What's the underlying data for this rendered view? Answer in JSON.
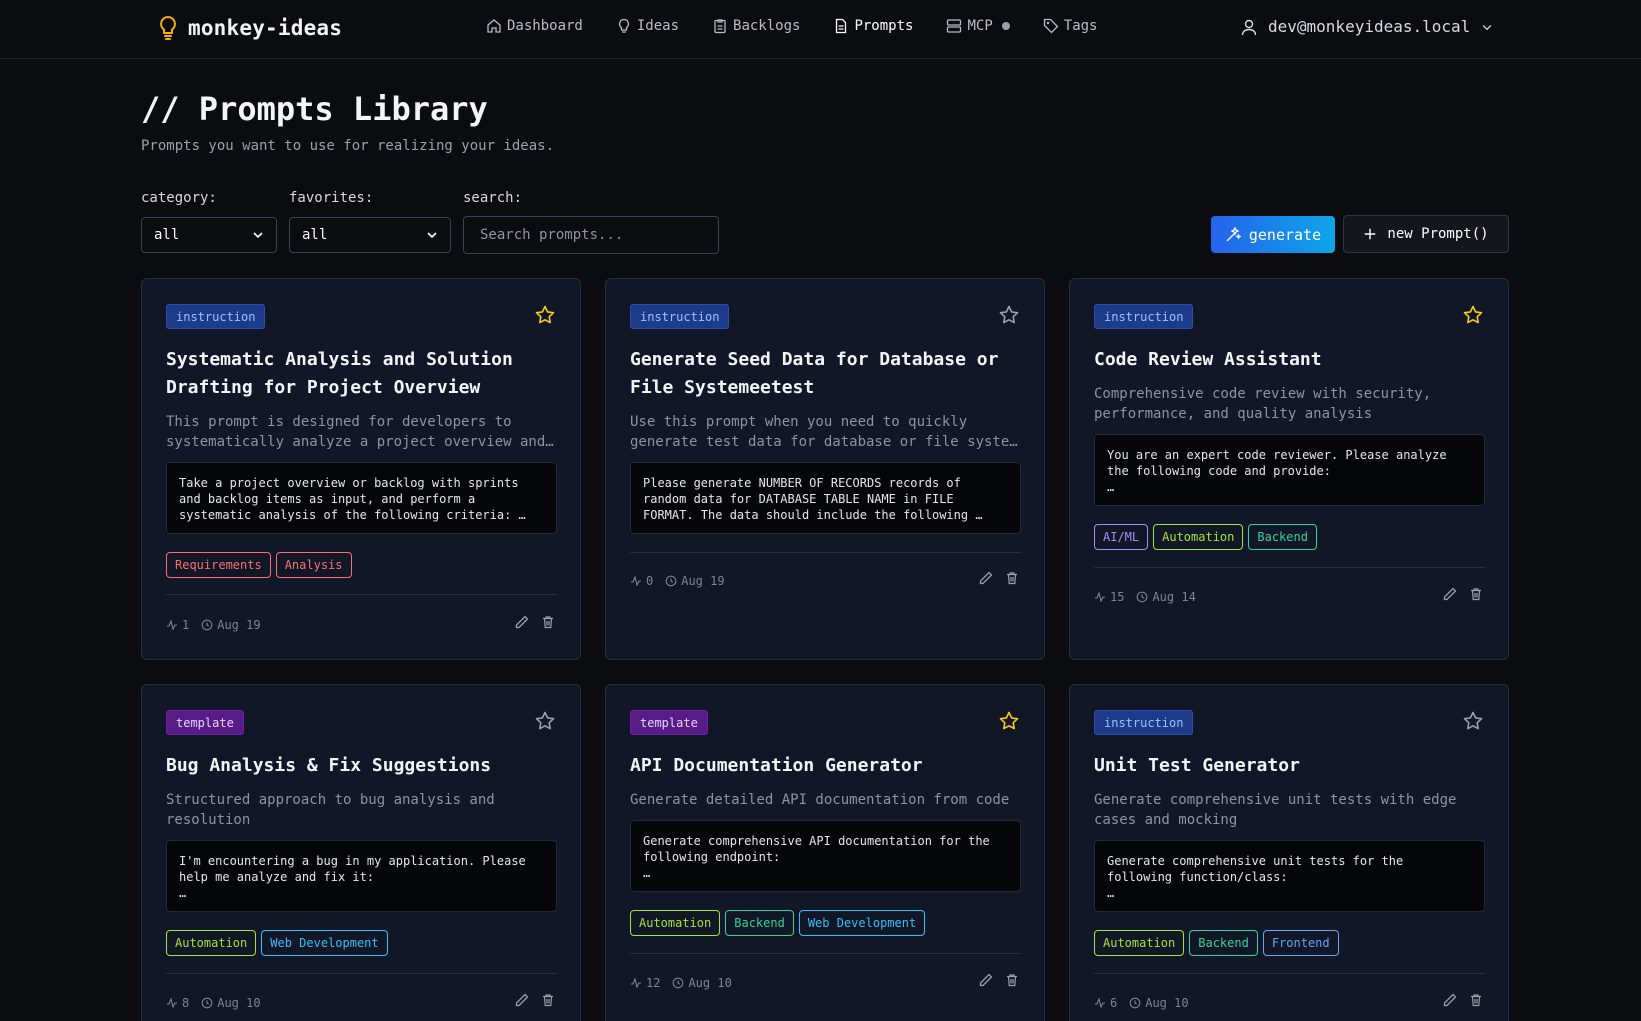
{
  "app": {
    "name": "monkey-ideas"
  },
  "nav": [
    {
      "label": "Dashboard",
      "icon": "home-icon"
    },
    {
      "label": "Ideas",
      "icon": "lightbulb-icon"
    },
    {
      "label": "Backlogs",
      "icon": "clipboard-icon"
    },
    {
      "label": "Prompts",
      "icon": "document-icon",
      "active": true
    },
    {
      "label": "MCP",
      "icon": "server-icon"
    },
    {
      "label": "Tags",
      "icon": "tag-icon"
    }
  ],
  "user": {
    "email": "dev@monkeyideas.local"
  },
  "header": {
    "title": "// Prompts Library",
    "subtitle": "Prompts you want to use for realizing your ideas."
  },
  "filters": {
    "category_label": "category:",
    "category_value": "all",
    "favorites_label": "favorites:",
    "favorites_value": "all",
    "search_label": "search:",
    "search_placeholder": "Search prompts..."
  },
  "actions": {
    "generate": "generate",
    "new_prompt": "new Prompt()"
  },
  "colors": {
    "accent": "#2563eb",
    "star_active": "#facc15",
    "instruction_badge": "#1e3a8a",
    "template_badge": "#581c87"
  },
  "cards": [
    {
      "type": "instruction",
      "favorite": true,
      "title": "Systematic Analysis and Solution Drafting for Project Overview",
      "description": "This prompt is designed for developers to systematically analyze a project overview and…",
      "content": "Take a project overview or backlog with sprints and backlog items as input, and perform a systematic analysis of the following criteria: …",
      "tags": [
        "Requirements",
        "Analysis"
      ],
      "uses": "1",
      "date": "Aug 19"
    },
    {
      "type": "instruction",
      "favorite": false,
      "title": "Generate Seed Data for Database or File Systemeetest",
      "description": "Use this prompt when you need to quickly generate test data for database or file syste…",
      "content": "Please generate NUMBER OF RECORDS records of random data for DATABASE TABLE NAME in FILE FORMAT. The data should include the following …",
      "tags": [],
      "uses": "0",
      "date": "Aug 19"
    },
    {
      "type": "instruction",
      "favorite": true,
      "title": "Code Review Assistant",
      "description": "Comprehensive code review with security, performance, and quality analysis",
      "content": "You are an expert code reviewer. Please analyze the following code and provide:\n…",
      "tags": [
        "AI/ML",
        "Automation",
        "Backend"
      ],
      "uses": "15",
      "date": "Aug 14"
    },
    {
      "type": "template",
      "favorite": false,
      "title": "Bug Analysis & Fix Suggestions",
      "description": "Structured approach to bug analysis and resolution",
      "content": "I'm encountering a bug in my application. Please help me analyze and fix it:\n…",
      "tags": [
        "Automation",
        "Web Development"
      ],
      "uses": "8",
      "date": "Aug 10"
    },
    {
      "type": "template",
      "favorite": true,
      "title": "API Documentation Generator",
      "description": "Generate detailed API documentation from code",
      "content": "Generate comprehensive API documentation for the following endpoint:\n…",
      "tags": [
        "Automation",
        "Backend",
        "Web Development"
      ],
      "uses": "12",
      "date": "Aug 10"
    },
    {
      "type": "instruction",
      "favorite": false,
      "title": "Unit Test Generator",
      "description": "Generate comprehensive unit tests with edge cases and mocking",
      "content": "Generate comprehensive unit tests for the following function/class:\n…",
      "tags": [
        "Automation",
        "Backend",
        "Frontend"
      ],
      "uses": "6",
      "date": "Aug 10"
    }
  ],
  "tag_colors": {
    "Requirements": "#f87171",
    "Analysis": "#f87171",
    "AI/ML": "#a78bfa",
    "Automation": "#a3e635",
    "Backend": "#34d399",
    "Web Development": "#38bdf8",
    "Frontend": "#60a5fa"
  }
}
